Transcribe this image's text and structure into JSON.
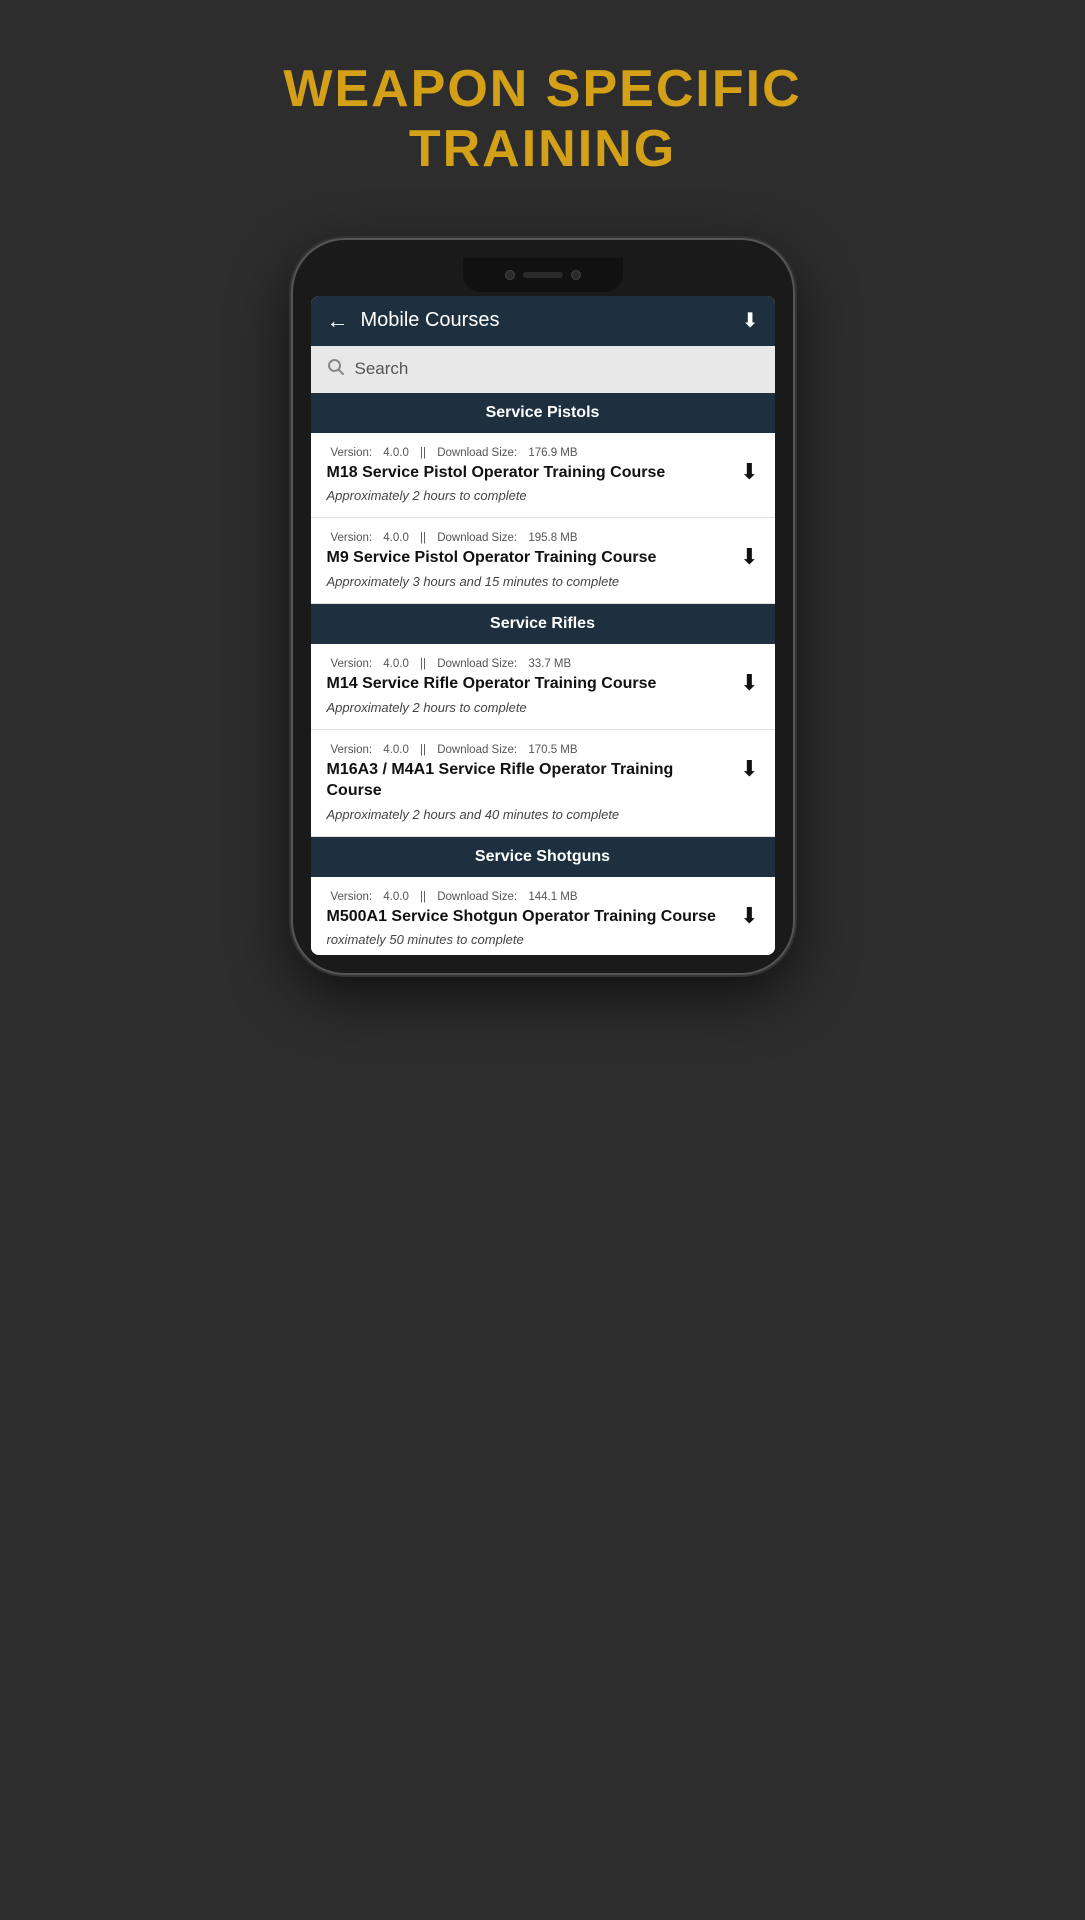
{
  "page": {
    "title_line1": "WEAPON SPECIFIC",
    "title_line2": "TRAINING"
  },
  "app_bar": {
    "title": "Mobile Courses",
    "back_icon": "←",
    "download_icon": "⬇"
  },
  "search": {
    "placeholder": "Search"
  },
  "sections": [
    {
      "id": "service-pistols",
      "label": "Service Pistols",
      "courses": [
        {
          "id": "m18",
          "version": "4.0.0",
          "download_size": "176.9 MB",
          "title": "M18 Service Pistol Operator Training Course",
          "duration": "Approximately 2 hours to complete"
        },
        {
          "id": "m9",
          "version": "4.0.0",
          "download_size": "195.8 MB",
          "title": "M9 Service Pistol Operator Training Course",
          "duration": "Approximately 3 hours and 15 minutes to complete"
        }
      ]
    },
    {
      "id": "service-rifles",
      "label": "Service Rifles",
      "courses": [
        {
          "id": "m14",
          "version": "4.0.0",
          "download_size": "33.7 MB",
          "title": "M14 Service Rifle Operator Training Course",
          "duration": "Approximately 2 hours to complete"
        },
        {
          "id": "m16a3-m4a1",
          "version": "4.0.0",
          "download_size": "170.5 MB",
          "title": "M16A3 / M4A1 Service Rifle Operator Training Course",
          "duration": "Approximately 2 hours and 40 minutes to complete"
        }
      ]
    },
    {
      "id": "service-shotguns",
      "label": "Service Shotguns",
      "courses": [
        {
          "id": "m500a1",
          "version": "4.0.0",
          "download_size": "144.1 MB",
          "title": "M500A1 Service Shotgun Operator Training Course",
          "duration": "roximately 50 minutes to complete"
        }
      ]
    }
  ],
  "labels": {
    "version_prefix": "Version:",
    "download_size_prefix": "Download Size:",
    "separator": "||"
  }
}
